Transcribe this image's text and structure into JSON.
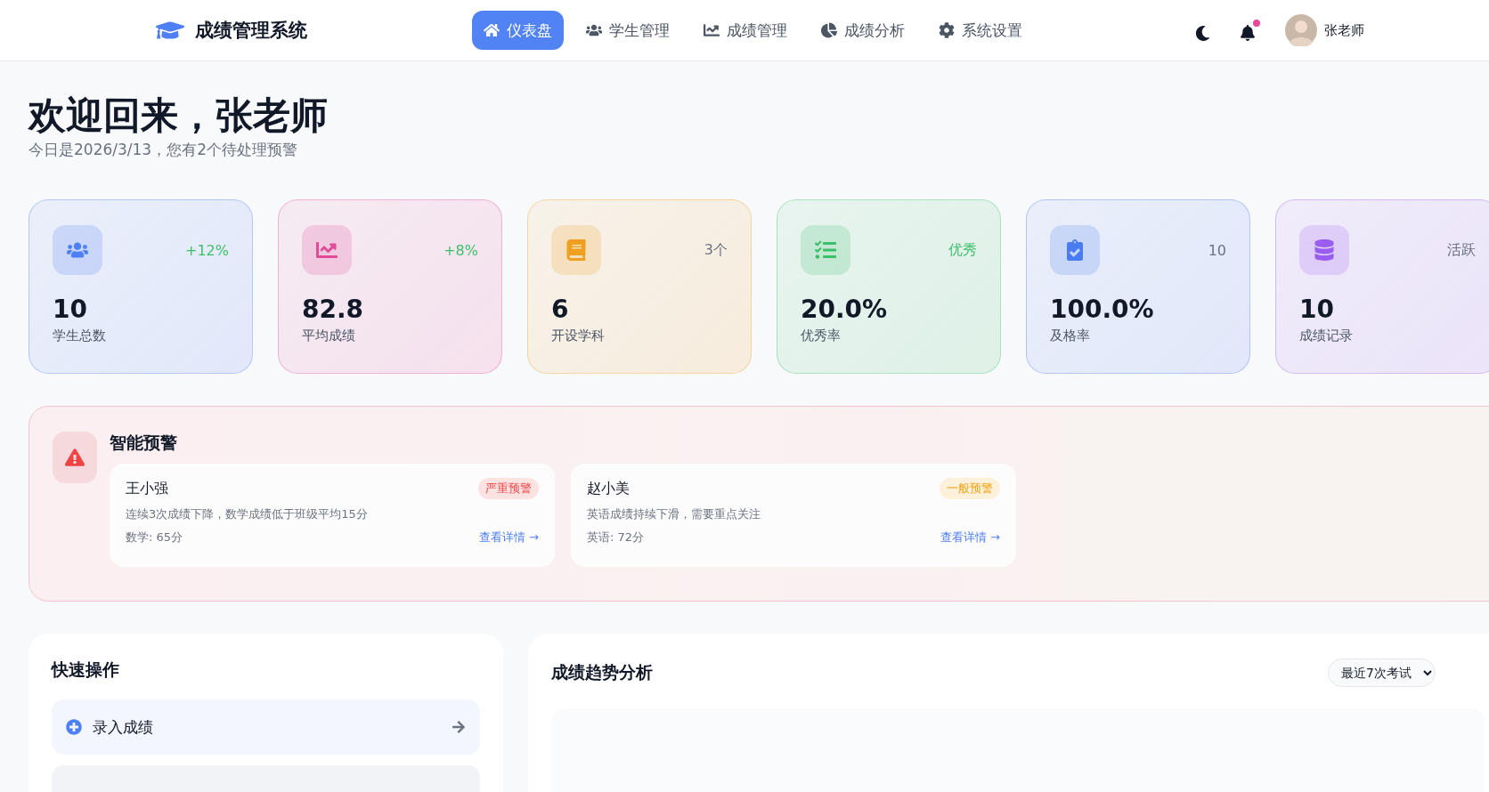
{
  "brand": "成绩管理系统",
  "nav": [
    {
      "label": "仪表盘",
      "selected": true
    },
    {
      "label": "学生管理",
      "selected": false
    },
    {
      "label": "成绩管理",
      "selected": false
    },
    {
      "label": "成绩分析",
      "selected": false
    },
    {
      "label": "系统设置",
      "selected": false
    }
  ],
  "notifications": {
    "unread": true
  },
  "user": {
    "name": "张老师"
  },
  "welcome": {
    "title": "欢迎回来，张老师",
    "subtitle": "今日是2026/3/13，您有2个待处理预警"
  },
  "stats": [
    {
      "value": "10",
      "label": "学生总数",
      "badge": "+12%",
      "color": "#4f7ff5",
      "positive": true
    },
    {
      "value": "82.8",
      "label": "平均成绩",
      "badge": "+8%",
      "color": "#e14c98",
      "positive": true
    },
    {
      "value": "6",
      "label": "开设学科",
      "badge": "3个",
      "color": "#f0a020",
      "positive": false
    },
    {
      "value": "20.0%",
      "label": "优秀率",
      "badge": "优秀",
      "color": "#3cbf6a",
      "positive": true
    },
    {
      "value": "100.0%",
      "label": "及格率",
      "badge": "10",
      "color": "#4a7cf0",
      "positive": false
    },
    {
      "value": "10",
      "label": "成绩记录",
      "badge": "活跃",
      "color": "#9b5cf0",
      "positive": false
    }
  ],
  "alerts": {
    "title": "智能预警",
    "items": [
      {
        "name": "王小强",
        "kind": "severe",
        "tag": "严重预警",
        "detail": "连续3次成绩下降，数学成绩低于班级平均15分",
        "score": "数学: 65分",
        "link": "查看详情 →"
      },
      {
        "name": "赵小美",
        "kind": "normal",
        "tag": "一般预警",
        "detail": "英语成绩持续下滑，需要重点关注",
        "score": "英语: 72分",
        "link": "查看详情 →"
      }
    ]
  },
  "quick_actions": {
    "title": "快速操作",
    "items": [
      {
        "label": "录入成绩"
      }
    ]
  },
  "trend": {
    "title": "成绩趋势分析",
    "range": "最近7次考试"
  }
}
